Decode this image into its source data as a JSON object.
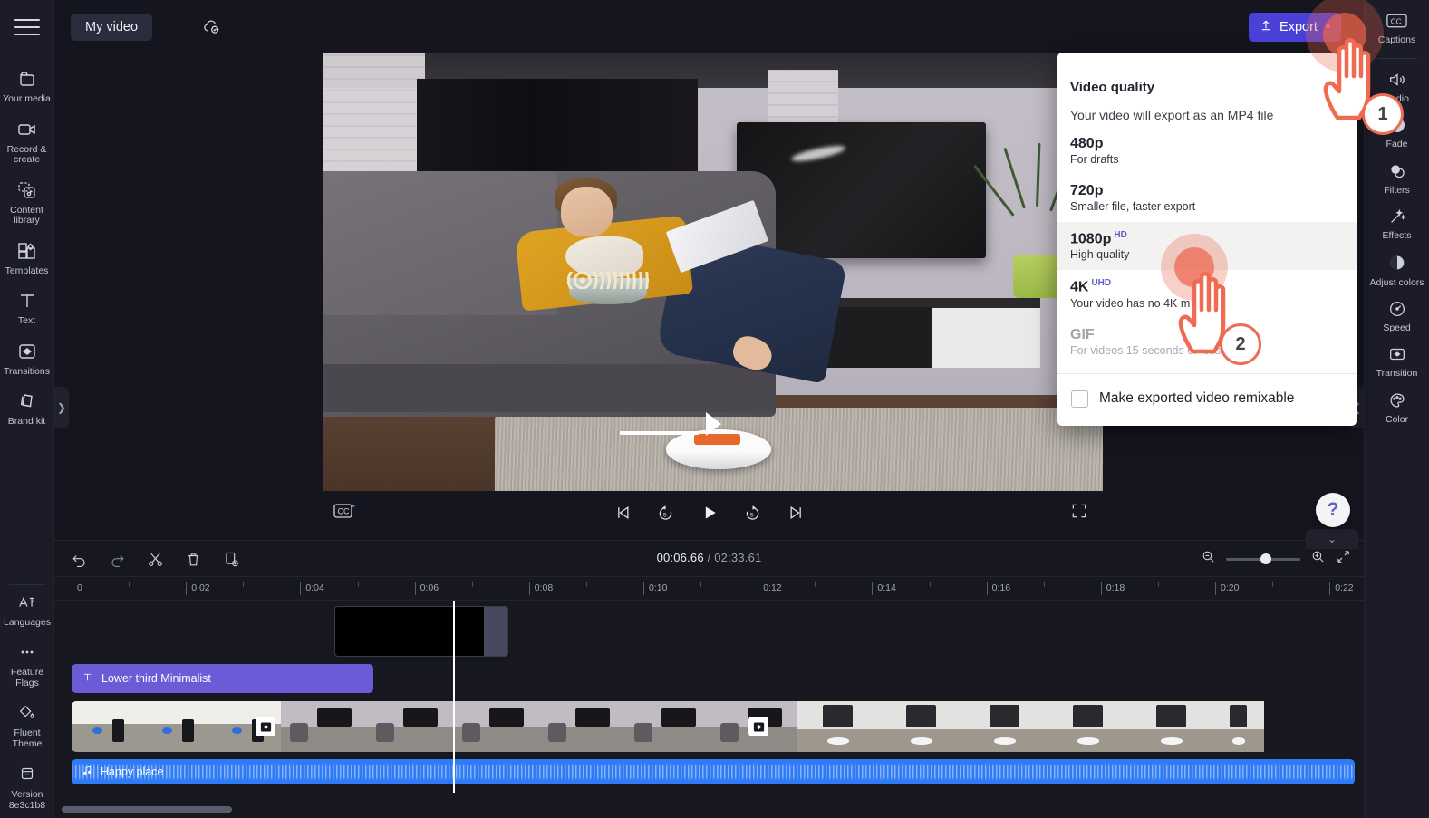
{
  "app": {
    "project_title": "My video",
    "save_status_icon": "cloud-check-icon",
    "menu_icon": "hamburger-menu-icon"
  },
  "toolbar": {
    "export_label": "Export",
    "export_icon": "upload-icon",
    "export_chevron": "chevron-down-icon",
    "export_color": "#4a42d8"
  },
  "left_sidebar": {
    "items": [
      {
        "label": "Your media",
        "icon": "media-folder-icon"
      },
      {
        "label": "Record & create",
        "icon": "video-camera-icon"
      },
      {
        "label": "Content library",
        "icon": "content-library-icon"
      },
      {
        "label": "Templates",
        "icon": "templates-icon"
      },
      {
        "label": "Text",
        "icon": "text-icon"
      },
      {
        "label": "Transitions",
        "icon": "transitions-icon"
      },
      {
        "label": "Brand kit",
        "icon": "brand-kit-icon"
      }
    ],
    "bottom_items": [
      {
        "label": "Languages",
        "icon": "languages-icon"
      },
      {
        "label": "Feature Flags",
        "icon": "ellipsis-icon"
      },
      {
        "label": "Fluent Theme",
        "icon": "fluent-theme-icon"
      },
      {
        "label": "Version 8e3c1b8",
        "icon": "version-icon"
      }
    ]
  },
  "right_sidebar": {
    "items": [
      {
        "label": "Captions",
        "icon": "cc-icon"
      },
      {
        "label": "Audio",
        "icon": "speaker-icon"
      },
      {
        "label": "Fade",
        "icon": "fade-icon"
      },
      {
        "label": "Filters",
        "icon": "filters-icon"
      },
      {
        "label": "Effects",
        "icon": "magic-wand-icon"
      },
      {
        "label": "Adjust colors",
        "icon": "adjust-colors-icon"
      },
      {
        "label": "Speed",
        "icon": "speedometer-icon"
      },
      {
        "label": "Transition",
        "icon": "transition-icon"
      },
      {
        "label": "Color",
        "icon": "palette-icon"
      }
    ]
  },
  "export_panel": {
    "title": "Video quality",
    "subtitle": "Your video will export as an MP4 file",
    "options": [
      {
        "label": "480p",
        "badge": "",
        "desc": "For drafts",
        "selected": false,
        "disabled": false
      },
      {
        "label": "720p",
        "badge": "",
        "desc": "Smaller file, faster export",
        "selected": false,
        "disabled": false
      },
      {
        "label": "1080p",
        "badge": "HD",
        "desc": "High quality",
        "selected": true,
        "disabled": false
      },
      {
        "label": "4K",
        "badge": "UHD",
        "desc": "Your video has no 4K m",
        "selected": false,
        "disabled": false
      },
      {
        "label": "GIF",
        "badge": "",
        "desc": "For videos 15 seconds or less",
        "selected": false,
        "disabled": true
      }
    ],
    "remix_label": "Make exported video remixable",
    "remix_checked": false,
    "badge_color": "#5b5fc7"
  },
  "annotations": {
    "markers": [
      {
        "number": "1",
        "target": "export-button"
      },
      {
        "number": "2",
        "target": "1080p-option"
      }
    ],
    "accent_color": "#ef6c52"
  },
  "player": {
    "cc_button_icon": "closed-caption-add-icon",
    "controls": [
      {
        "icon": "skip-previous-icon",
        "name": "skip-to-start-button"
      },
      {
        "icon": "rewind-5-icon",
        "name": "rewind-five-seconds-button"
      },
      {
        "icon": "play-icon",
        "name": "play-button"
      },
      {
        "icon": "forward-5-icon",
        "name": "forward-five-seconds-button"
      },
      {
        "icon": "skip-next-icon",
        "name": "skip-to-end-button"
      }
    ],
    "fullscreen_icon": "fullscreen-icon"
  },
  "timeline": {
    "tools": [
      {
        "icon": "undo-icon",
        "name": "undo-button"
      },
      {
        "icon": "redo-icon",
        "name": "redo-button"
      },
      {
        "icon": "scissors-icon",
        "name": "split-button"
      },
      {
        "icon": "trash-icon",
        "name": "delete-button"
      },
      {
        "icon": "duplicate-icon",
        "name": "duplicate-button"
      }
    ],
    "current_time": "00:06.66",
    "total_time": "/ 02:33.61",
    "zoom_out_icon": "zoom-out-icon",
    "zoom_in_icon": "zoom-in-icon",
    "fit_icon": "fit-to-screen-icon",
    "zoom_level_percent": 46,
    "ruler_labels": [
      "0",
      "0:02",
      "0:04",
      "0:06",
      "0:08",
      "0:10",
      "0:12",
      "0:14",
      "0:16",
      "0:18",
      "0:20",
      "0:22"
    ],
    "playhead_time": "00:06.66",
    "tracks": {
      "overlay_clip": {
        "name": "black-overlay-clip"
      },
      "text_clip": {
        "label": "Lower third Minimalist",
        "icon": "text-icon"
      },
      "video_clip": {
        "name": "video-clip",
        "transition_icon": "transition-icon"
      },
      "audio_clip": {
        "label": "Happy place",
        "icon": "music-note-icon"
      }
    }
  },
  "help": {
    "label": "?"
  },
  "preview": {
    "scene_description": "woman on couch with cat, laptop and popcorn; robot vacuum on rug",
    "arrow_annotation": "white-arrow-pointing-right"
  }
}
